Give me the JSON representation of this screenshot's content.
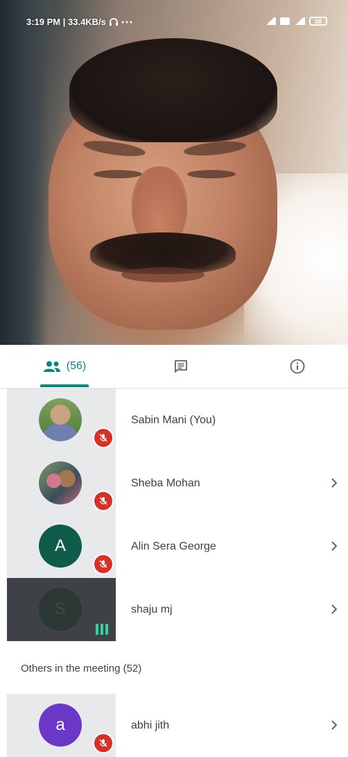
{
  "status_bar": {
    "time_speed": "3:19 PM | 33.4KB/s",
    "battery": "38"
  },
  "tabs": {
    "people_count": "(56)"
  },
  "participants": [
    {
      "name": "Sabin Mani (You)",
      "avatar_letter": ""
    },
    {
      "name": "Sheba Mohan",
      "avatar_letter": ""
    },
    {
      "name": "Alin Sera George",
      "avatar_letter": "A"
    },
    {
      "name": "shaju mj",
      "avatar_letter": "S"
    }
  ],
  "others_section": {
    "title": "Others in the meeting (52)"
  },
  "others": [
    {
      "name": "abhi jith",
      "avatar_letter": "a"
    }
  ],
  "colors": {
    "accent": "#00897b",
    "mute_red": "#d93025",
    "speaking_green": "#34d399"
  }
}
